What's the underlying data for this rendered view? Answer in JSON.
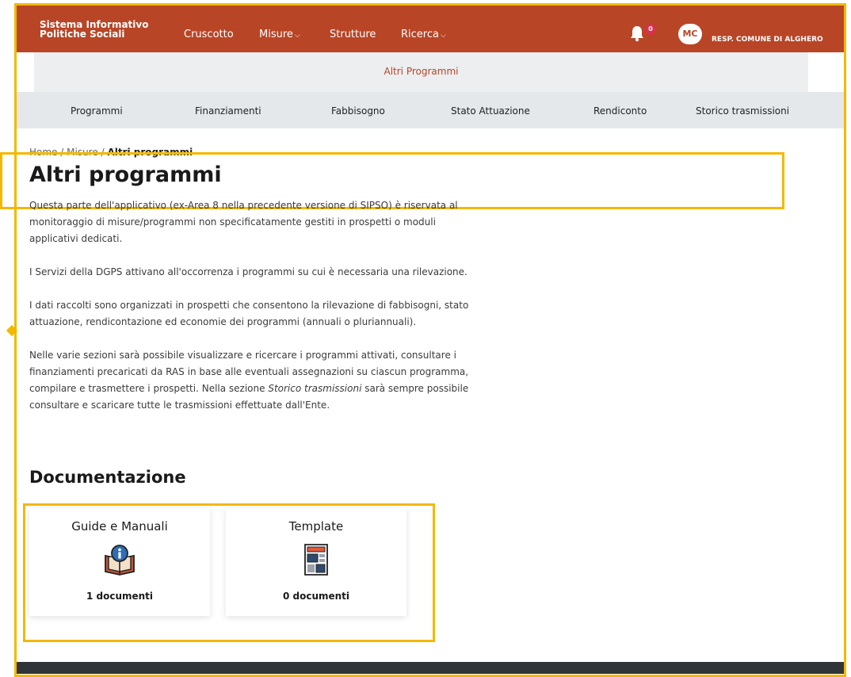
{
  "header": {
    "brand_line1": "Sistema Informativo",
    "brand_line2": "Politiche Sociali",
    "nav": [
      "Cruscotto",
      "Misure",
      "Strutture",
      "Ricerca"
    ],
    "notification_count": "0",
    "avatar_initials": "MC",
    "user_name": "RESP. COMUNE DI ALGHERO"
  },
  "subheader": {
    "title": "Altri Programmi"
  },
  "tabs": [
    "Programmi",
    "Finanziamenti",
    "Fabbisogno",
    "Stato Attuazione",
    "Rendiconto",
    "Storico trasmissioni"
  ],
  "breadcrumb": {
    "home": "Home",
    "sep": "/",
    "level1": "Misure",
    "current": "Altri programmi"
  },
  "page": {
    "title": "Altri programmi",
    "p1": "Questa parte dell'applicativo (ex-Area 8 nella precedente versione di SIPSO) è riservata al monitoraggio di misure/programmi non specificatamente gestiti in prospetti o moduli applicativi dedicati.",
    "p2": "I Servizi della DGPS attivano all'occorrenza i programmi su cui è necessaria una rilevazione.",
    "p3": "I dati raccolti sono organizzati in prospetti che consentono la rilevazione di fabbisogni, stato attuazione, rendicontazione ed economie dei programmi (annuali o pluriannuali).",
    "p4_a": "Nelle varie sezioni sarà possibile visualizzare e ricercare i programmi attivati, consultare i finanziamenti precaricati da RAS in base alle eventuali assegnazioni su ciascun programma, compilare e trasmettere i prospetti. Nella sezione ",
    "p4_em": "Storico trasmissioni",
    "p4_b": " sarà sempre possibile consultare e scaricare tutte le trasmissioni effettuate dall'Ente."
  },
  "documentazione": {
    "title": "Documentazione",
    "cards": [
      {
        "title": "Guide e Manuali",
        "count": "1 documenti",
        "icon": "book-info-icon"
      },
      {
        "title": "Template",
        "count": "0 documenti",
        "icon": "template-document-icon"
      }
    ]
  },
  "colors": {
    "brand": "#b84526",
    "highlight": "#f4b800"
  }
}
